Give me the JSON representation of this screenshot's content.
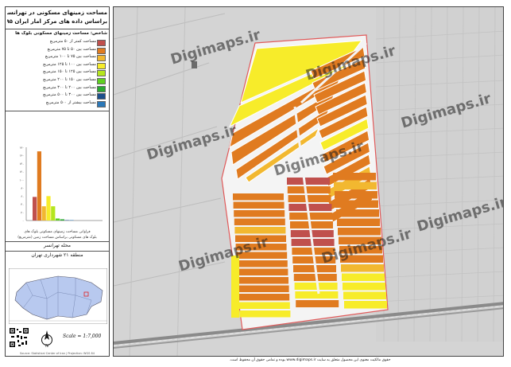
{
  "title_line1": "مساحت زمینهای مسکونی در تهرانسر",
  "title_line2": "براساس داده های مرکز آمار ایران ۱۳۹۵",
  "legend": {
    "title": "شاخص: مساحت زمینهای مسکونی بلوک ها",
    "items": [
      {
        "label": "مساحت کمتر از ۵۰ مترمربع",
        "color": "#c0504d"
      },
      {
        "label": "مساحت بین ۵۰ تا ۷۵ مترمربع",
        "color": "#e07b20"
      },
      {
        "label": "مساحت بین ۷۵ تا ۱۰۰ مترمربع",
        "color": "#f2b830"
      },
      {
        "label": "مساحت بین ۱۰۰ تا ۱۲۵ مترمربع",
        "color": "#f7ec2a"
      },
      {
        "label": "مساحت بین ۱۲۵ تا ۱۵۰ مترمربع",
        "color": "#b5e61d"
      },
      {
        "label": "مساحت بین ۱۵۰ تا ۲۰۰ مترمربع",
        "color": "#5fd021"
      },
      {
        "label": "مساحت بین ۲۰۰ تا ۳۰۰ مترمربع",
        "color": "#2aa832"
      },
      {
        "label": "مساحت بین ۳۰۰ تا ۵۰۰ مترمربع",
        "color": "#1c4f8c"
      },
      {
        "label": "مساحت بیشتر از ۵۰۰ مترمربع",
        "color": "#2b78b8"
      }
    ]
  },
  "chart_data": {
    "type": "bar",
    "categories": [
      "<50",
      "50-75",
      "75-100",
      "100-125",
      "125-150",
      "150-200",
      "200-300",
      "300-500",
      ">500"
    ],
    "values": [
      58,
      170,
      35,
      60,
      35,
      5,
      3,
      1,
      1
    ],
    "colors": [
      "#c0504d",
      "#e07b20",
      "#f2b830",
      "#f7ec2a",
      "#b5e61d",
      "#5fd021",
      "#2aa832",
      "#1c4f8c",
      "#2b78b8"
    ],
    "ylim": [
      0,
      180
    ],
    "yticks": [
      "۰",
      "۲۰",
      "۴۰",
      "۶۰",
      "۸۰",
      "۱۰۰",
      "۱۲۰",
      "۱۴۰",
      "۱۶۰",
      "۱۸۰"
    ],
    "caption1": "فراوانی مساحت زمینهای مسکونی بلوک های",
    "caption2": "بلوک های مسکونی براساس مساحت زمین (مترمربع)"
  },
  "area_title": "محله تهرانسر",
  "region_title": "منطقه ۲۱ شهرداری تهران",
  "scale_text": "Scale = 1:7,000",
  "north_label": "N",
  "small_footer": "Source: Statistical Center of Iran | Projection: WGS 84",
  "watermark": "Digimaps.ir",
  "copyright": "حقوق مالکیت معنوی این محصول متعلق به سایت www.digimaps.ir بوده و تمامی حقوق آن محفوظ است."
}
